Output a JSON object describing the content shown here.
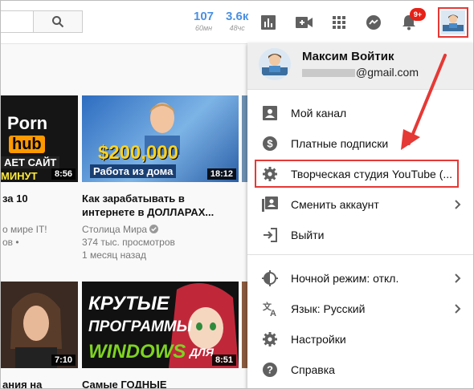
{
  "topbar": {
    "stats": [
      {
        "value": "107",
        "label": "60мн"
      },
      {
        "value": "3.6к",
        "label": "48чс"
      }
    ],
    "notification_count": "9+"
  },
  "videos": [
    {
      "thumb_text_1": "Porn",
      "thumb_text_2": "hub",
      "thumb_text_3": "АЕТ САЙТ",
      "thumb_text_4": "МИНУТ",
      "duration": "8:56",
      "title": "за 10",
      "meta_1": "о мире IT!",
      "meta_2": "ов •"
    },
    {
      "thumb_text_1": "$200,000",
      "thumb_text_2": "Работа из дома",
      "duration": "18:12",
      "title_1": "Как зарабатывать в",
      "title_2": "интернете в ДОЛЛАРАХ...",
      "channel": "Столица Мира",
      "views": "374 тыс. просмотров",
      "age": "1 месяц назад"
    },
    {
      "duration": "7:10",
      "title": "ания на"
    },
    {
      "thumb_text_1": "КРУТЫЕ",
      "thumb_text_2": "ПРОГРАММЫ",
      "thumb_text_3": "WINDOWS",
      "thumb_text_4": "ДЛЯ",
      "duration": "8:51",
      "title": "Самые ГОДНЫЕ"
    }
  ],
  "menu": {
    "user_name": "Максим Войтик",
    "email_suffix": "@gmail.com",
    "items": [
      {
        "label": "Мой канал",
        "icon": "account-box-icon"
      },
      {
        "label": "Платные подписки",
        "icon": "dollar-circle-icon"
      },
      {
        "label": "Творческая студия YouTube (...",
        "icon": "gear-icon"
      },
      {
        "label": "Сменить аккаунт",
        "icon": "switch-account-icon"
      },
      {
        "label": "Выйти",
        "icon": "sign-out-icon"
      },
      {
        "label": "Ночной режим: откл.",
        "icon": "night-mode-icon"
      },
      {
        "label": "Язык: Русский",
        "icon": "translate-icon"
      },
      {
        "label": "Настройки",
        "icon": "settings-icon"
      },
      {
        "label": "Справка",
        "icon": "help-icon"
      }
    ]
  },
  "colors": {
    "accent": "#e53935",
    "stat_blue": "#4a90e2",
    "badge": "#e62117"
  }
}
